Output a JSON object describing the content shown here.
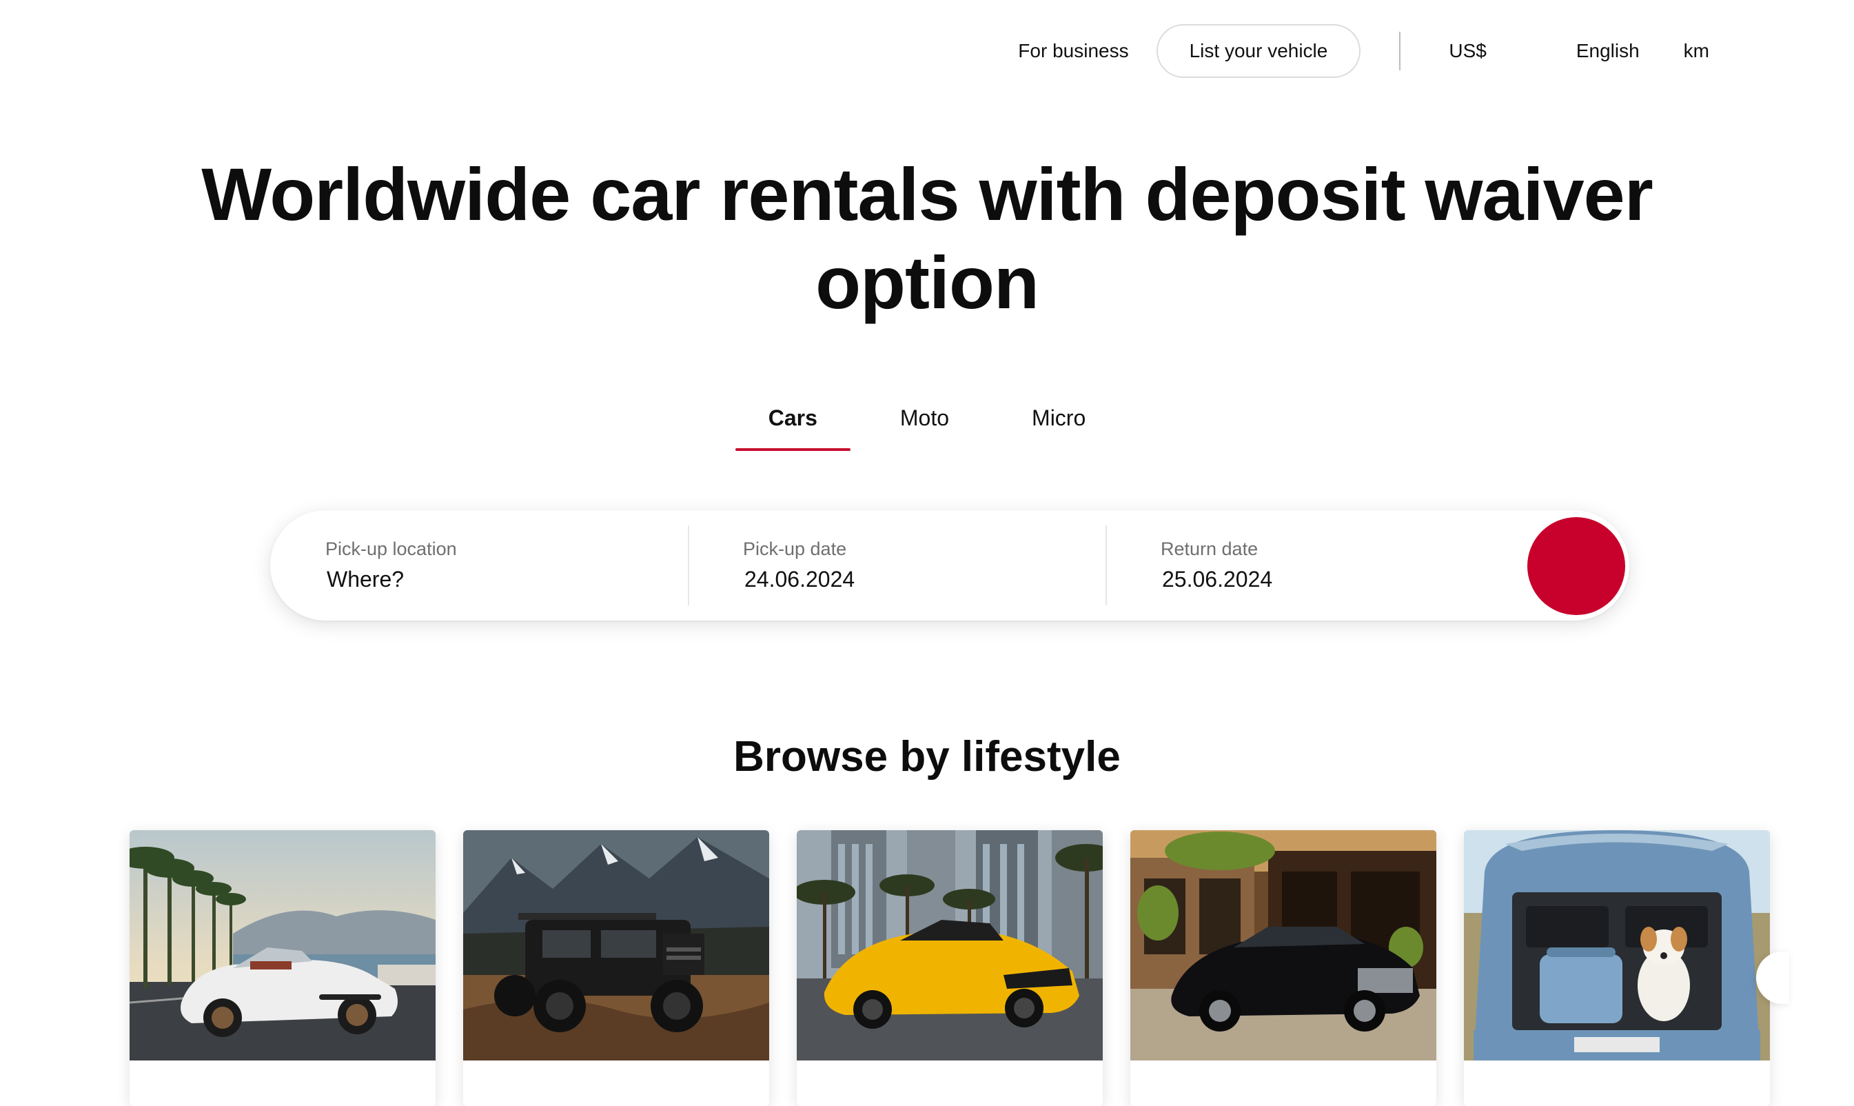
{
  "header": {
    "for_business": "For business",
    "list_vehicle": "List your vehicle",
    "currency": "US$",
    "language": "English",
    "distance_unit": "km"
  },
  "hero": {
    "title_line1": "Worldwide car rentals with deposit waiver",
    "title_line2": "option"
  },
  "tabs": [
    {
      "label": "Cars",
      "active": true
    },
    {
      "label": "Moto",
      "active": false
    },
    {
      "label": "Micro",
      "active": false
    }
  ],
  "search": {
    "pickup_location": {
      "label": "Pick-up location",
      "value": "Where?"
    },
    "pickup_date": {
      "label": "Pick-up date",
      "value": "24.06.2024"
    },
    "return_date": {
      "label": "Return date",
      "value": "25.06.2024"
    }
  },
  "lifestyle": {
    "title": "Browse by lifestyle",
    "cards": [
      {
        "image": "white-convertible-sports-car-seaside"
      },
      {
        "image": "black-offroad-jeep-mountains"
      },
      {
        "image": "yellow-supercar-palm-trees-city"
      },
      {
        "image": "black-luxury-sedan-street-cafe"
      },
      {
        "image": "blue-hatchback-dog-in-trunk"
      }
    ]
  },
  "colors": {
    "accent": "#c8002c",
    "tab_underline": "#c8102e",
    "text": "#111111",
    "muted": "#6f6f6f"
  }
}
